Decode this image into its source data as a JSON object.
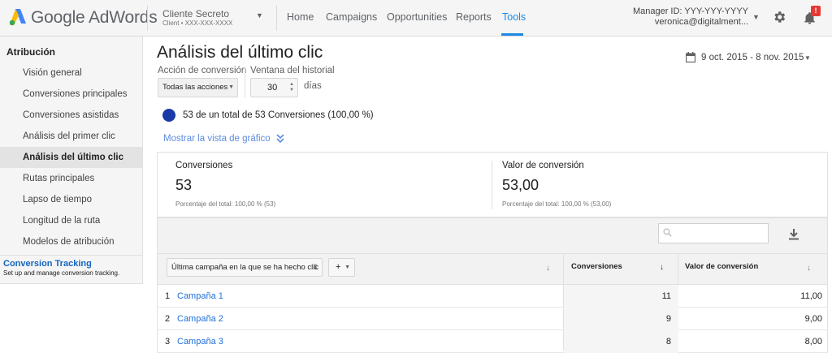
{
  "header": {
    "brand": "Google AdWords",
    "account_name": "Cliente Secreto",
    "account_sub": "Client  •  XXX-XXX-XXXX",
    "nav": [
      "Home",
      "Campaigns",
      "Opportunities",
      "Reports",
      "Tools"
    ],
    "active_nav": "Tools",
    "manager_id": "Manager ID: YYY-YYY-YYYY",
    "email": "veronica@digitalment...",
    "notification_badge": "!"
  },
  "sidebar": {
    "heading": "Atribución",
    "items": [
      "Visión general",
      "Conversiones principales",
      "Conversiones asistidas",
      "Análisis del primer clic",
      "Análisis del último clic",
      "Rutas principales",
      "Lapso de tiempo",
      "Longitud de la ruta",
      "Modelos de atribución"
    ],
    "active_item": "Análisis del último clic",
    "conversion_tracking": {
      "title": "Conversion Tracking",
      "desc": "Set up and manage conversion tracking."
    }
  },
  "main": {
    "title": "Análisis del último clic",
    "date_range": "9 oct. 2015 - 8 nov. 2015",
    "accion_label": "Acción de conversión",
    "accion_value": "Todas las acciones",
    "ventana_label": "Ventana del historial",
    "ventana_value": "30",
    "dias": "días",
    "summary": "53 de un total de 53 Conversiones (100,00 %)",
    "graph_link": "Mostrar la vista de gráfico",
    "colors": {
      "accent": "#1e88e5",
      "dot": "#1a3aa8",
      "link": "#1e6fd9",
      "badge": "#e53935"
    }
  },
  "stats": [
    {
      "label": "Conversiones",
      "value": "53",
      "note": "Porcentaje del total: 100,00 % (53)"
    },
    {
      "label": "Valor de conversión",
      "value": "53,00",
      "note": "Porcentaje del total: 100,00 % (53,00)"
    }
  ],
  "table": {
    "segment_select": "Última campaña en la que se ha hecho clic",
    "plus": "+",
    "columns": [
      "Conversiones",
      "Valor de conversión"
    ],
    "rows": [
      {
        "n": "1",
        "campaign": "Campaña 1",
        "conversions": "11",
        "value": "11,00"
      },
      {
        "n": "2",
        "campaign": "Campaña 2",
        "conversions": "9",
        "value": "9,00"
      },
      {
        "n": "3",
        "campaign": "Campaña 3",
        "conversions": "8",
        "value": "8,00"
      }
    ]
  }
}
